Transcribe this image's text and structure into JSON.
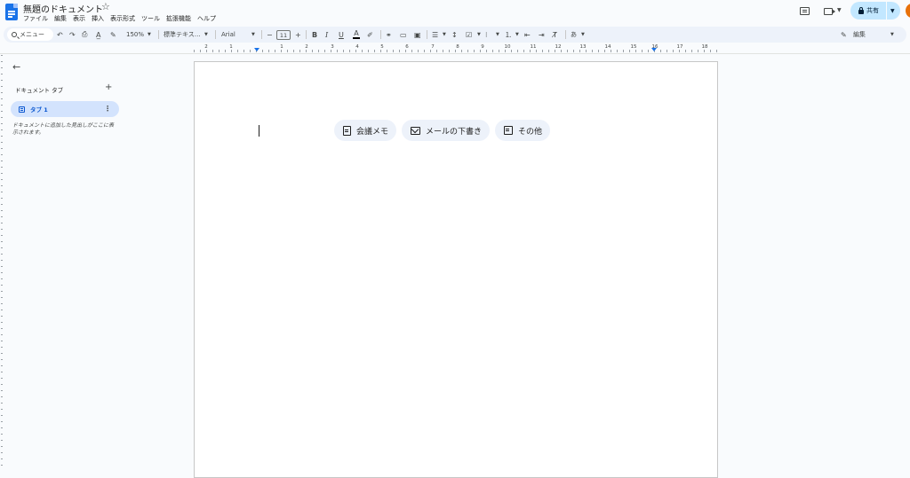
{
  "app": {
    "title": "無題のドキュメント",
    "star_icon": "star-icon",
    "menus": [
      "ファイル",
      "編集",
      "表示",
      "挿入",
      "表示形式",
      "ツール",
      "拡張機能",
      "ヘルプ"
    ]
  },
  "header": {
    "share_label": "共有",
    "accent_color": "#c2e7ff"
  },
  "toolbar": {
    "search_placeholder": "メニュー",
    "zoom": "150%",
    "style": "標準テキス…",
    "font": "Arial",
    "font_size": "11",
    "bold": "B",
    "italic": "I",
    "underline": "U",
    "text_color": "A",
    "input_tools": "あ",
    "mode_label": "編集"
  },
  "ruler": {
    "numbers": [
      "2",
      "1",
      "1",
      "2",
      "3",
      "4",
      "5",
      "6",
      "7",
      "8",
      "9",
      "10",
      "11",
      "12",
      "13",
      "14",
      "15",
      "16",
      "17",
      "18"
    ]
  },
  "sidebar": {
    "header": "ドキュメント タブ",
    "add_icon": "plus-icon",
    "tab_label": "タブ 1",
    "hint": "ドキュメントに追加した見出しがここに表示されます。"
  },
  "document": {
    "chips": [
      "会議メモ",
      "メールの下書き",
      "その他"
    ]
  }
}
